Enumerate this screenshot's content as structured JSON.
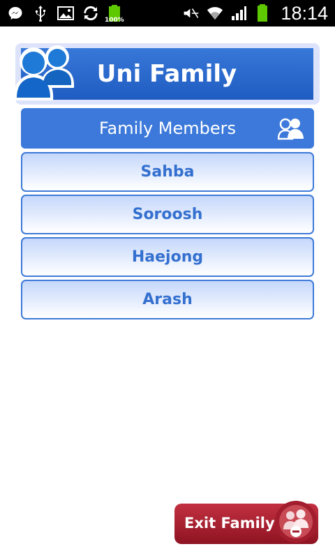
{
  "status_bar": {
    "battery_percent": "100%",
    "time": "18:14"
  },
  "header": {
    "title": "Uni Family",
    "logo_icon": "family-people-icon"
  },
  "members_section": {
    "title": "Family Members",
    "icon": "group-icon"
  },
  "members": [
    "Sahba",
    "Soroosh",
    "Haejong",
    "Arash"
  ],
  "exit_button": {
    "label": "Exit Family",
    "icon": "remove-member-icon"
  },
  "colors": {
    "primary_blue": "#3c79da",
    "exit_red": "#a21d2d"
  }
}
